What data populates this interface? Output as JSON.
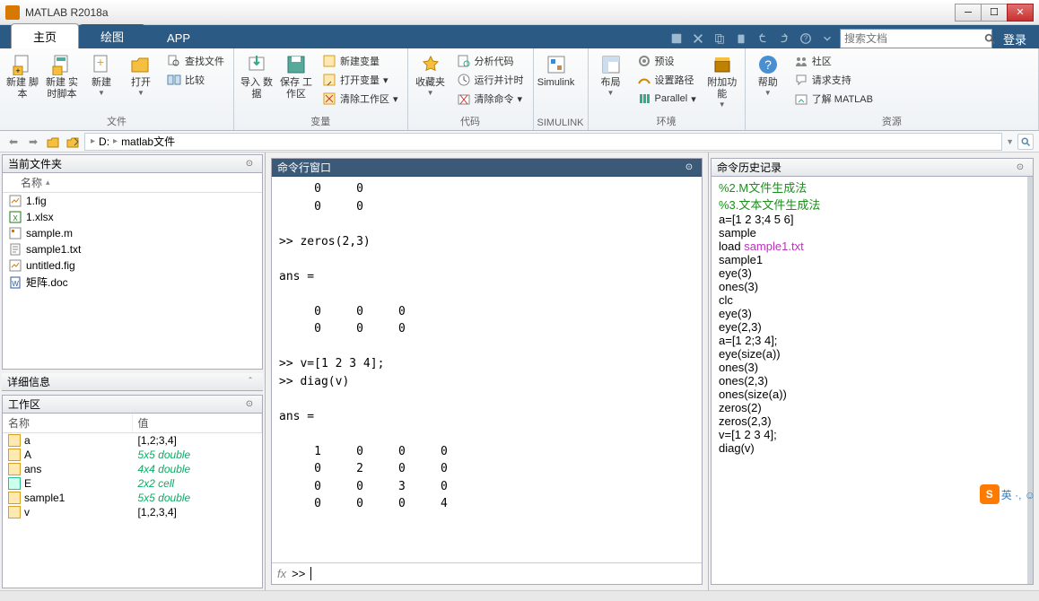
{
  "titlebar": {
    "title": "MATLAB R2018a"
  },
  "tabs": {
    "home": "主页",
    "plots": "绘图",
    "apps": "APP"
  },
  "search": {
    "placeholder": "搜索文档"
  },
  "login": "登录",
  "ribbon": {
    "file_group": "文件",
    "new_script": "新建\n脚本",
    "new_live": "新建\n实时脚本",
    "new": "新建",
    "open": "打开",
    "find_files": "查找文件",
    "compare": "比较",
    "var_group": "变量",
    "import": "导入\n数据",
    "save_ws": "保存\n工作区",
    "new_var": "新建变量",
    "open_var": "打开变量",
    "clear_ws": "清除工作区",
    "code_group": "代码",
    "favorites": "收藏夹",
    "analyze": "分析代码",
    "runtime": "运行并计时",
    "clear_cmd": "清除命令",
    "simulink_group": "SIMULINK",
    "simulink": "Simulink",
    "env_group": "环境",
    "layout": "布局",
    "prefs": "预设",
    "setpath": "设置路径",
    "parallel": "Parallel",
    "addons": "附加功能",
    "res_group": "资源",
    "help": "帮助",
    "community": "社区",
    "support": "请求支持",
    "learn": "了解 MATLAB"
  },
  "path": {
    "drive": "D:",
    "folder": "matlab文件"
  },
  "panels": {
    "current_folder": "当前文件夹",
    "name_col": "名称",
    "details": "详细信息",
    "workspace": "工作区",
    "ws_name": "名称",
    "ws_value": "值",
    "command_window": "命令行窗口",
    "history": "命令历史记录"
  },
  "files": [
    {
      "name": "1.fig",
      "type": "fig"
    },
    {
      "name": "1.xlsx",
      "type": "xlsx"
    },
    {
      "name": "sample.m",
      "type": "m"
    },
    {
      "name": "sample1.txt",
      "type": "txt"
    },
    {
      "name": "untitled.fig",
      "type": "fig"
    },
    {
      "name": "矩阵.doc",
      "type": "doc"
    }
  ],
  "workspace_vars": [
    {
      "name": "a",
      "value": "[1,2;3,4]",
      "link": false,
      "icon": "num"
    },
    {
      "name": "A",
      "value": "5x5 double",
      "link": true,
      "icon": "num"
    },
    {
      "name": "ans",
      "value": "4x4 double",
      "link": true,
      "icon": "num"
    },
    {
      "name": "E",
      "value": "2x2 cell",
      "link": true,
      "icon": "cell"
    },
    {
      "name": "sample1",
      "value": "5x5 double",
      "link": true,
      "icon": "num"
    },
    {
      "name": "v",
      "value": "[1,2,3,4]",
      "link": false,
      "icon": "num"
    }
  ],
  "command_output": "     0     0\n     0     0\n\n>> zeros(2,3)\n\nans =\n\n     0     0     0\n     0     0     0\n\n>> v=[1 2 3 4];\n>> diag(v)\n\nans =\n\n     1     0     0     0\n     0     2     0     0\n     0     0     3     0\n     0     0     0     4\n",
  "prompt": ">> ",
  "fx_label": "fx",
  "history_lines": [
    {
      "text": "%2.M文件生成法",
      "cls": "hist-comment"
    },
    {
      "text": "%3.文本文件生成法",
      "cls": "hist-comment"
    },
    {
      "text": "a=[1 2 3;4 5 6]",
      "cls": ""
    },
    {
      "text": "sample",
      "cls": ""
    },
    {
      "text": "load ",
      "cls": "",
      "tail": "sample1.txt",
      "tailcls": "hist-magenta"
    },
    {
      "text": "sample1",
      "cls": ""
    },
    {
      "text": "eye(3)",
      "cls": ""
    },
    {
      "text": "ones(3)",
      "cls": ""
    },
    {
      "text": "clc",
      "cls": ""
    },
    {
      "text": "eye(3)",
      "cls": ""
    },
    {
      "text": "eye(2,3)",
      "cls": ""
    },
    {
      "text": "a=[1 2;3 4];",
      "cls": ""
    },
    {
      "text": "eye(size(a))",
      "cls": ""
    },
    {
      "text": "ones(3)",
      "cls": ""
    },
    {
      "text": "ones(2,3)",
      "cls": ""
    },
    {
      "text": "ones(size(a))",
      "cls": ""
    },
    {
      "text": "zeros(2)",
      "cls": ""
    },
    {
      "text": "zeros(2,3)",
      "cls": ""
    },
    {
      "text": "v=[1 2 3 4];",
      "cls": ""
    },
    {
      "text": "diag(v)",
      "cls": ""
    }
  ],
  "ime": {
    "badge": "S",
    "text": "英 ·, ☺"
  }
}
